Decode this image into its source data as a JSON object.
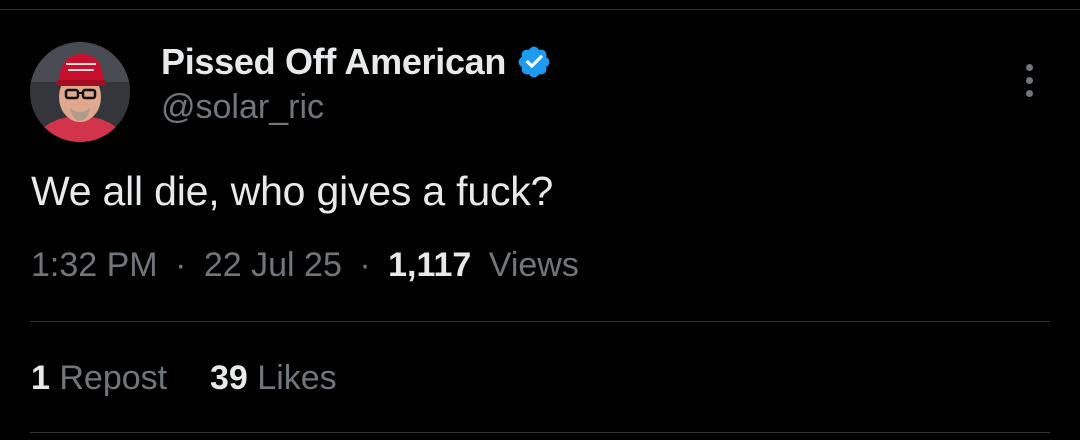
{
  "author": {
    "display_name": "Pissed Off American",
    "handle": "@solar_ric",
    "verified": true,
    "verified_color": "#1d9bf0",
    "avatar_icon": "profile-photo"
  },
  "tweet": {
    "text": "We all die, who gives a fuck?",
    "time": "1:32 PM",
    "date": "22 Jul 25",
    "separator": "·",
    "views_count": "1,117",
    "views_label": "Views"
  },
  "stats": {
    "reposts_count": "1",
    "reposts_label": "Repost",
    "likes_count": "39",
    "likes_label": "Likes"
  },
  "icons": {
    "more": "more-options-icon",
    "verified": "verified-badge-icon"
  },
  "colors": {
    "background": "#000000",
    "text_primary": "#e7e9ea",
    "text_secondary": "#71767b",
    "divider": "#2f3336",
    "accent": "#1d9bf0"
  }
}
